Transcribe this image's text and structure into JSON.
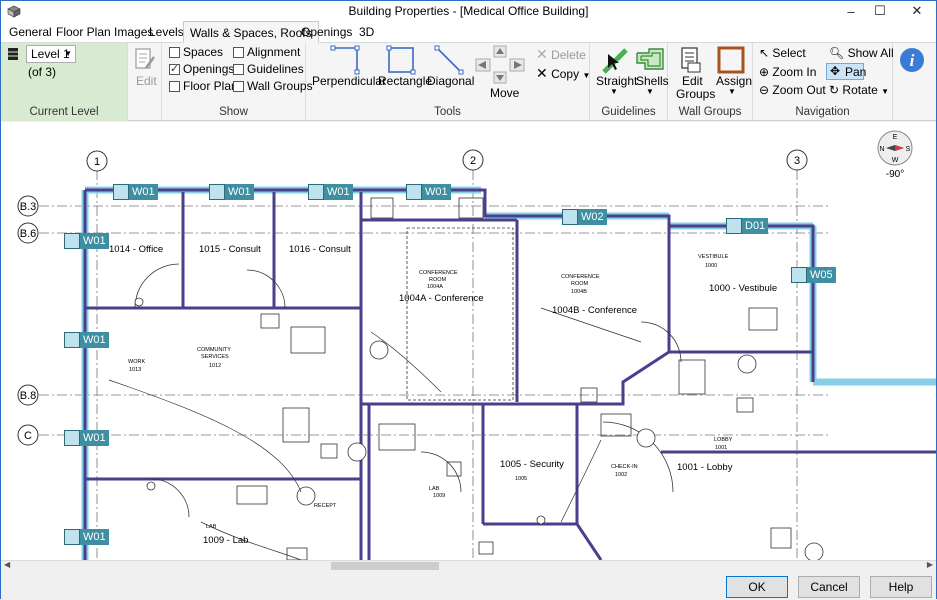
{
  "window": {
    "title": "Building Properties - [Medical Office Building]",
    "controls": {
      "minimize": "–",
      "maximize": "☐",
      "close": "✕"
    }
  },
  "menu": {
    "tabs": [
      "General",
      "Floor Plan Images",
      "Levels",
      "Walls & Spaces, Roofs",
      "Openings",
      "3D"
    ],
    "active": "Walls & Spaces, Roofs"
  },
  "ribbon": {
    "current_level": {
      "level_select": "Level 1",
      "of_text": "(of 3)",
      "group_label": "Current Level"
    },
    "edit": {
      "label": "Edit"
    },
    "show": {
      "group_label": "Show",
      "items": [
        {
          "label": "Spaces",
          "checked": false
        },
        {
          "label": "Openings",
          "checked": true
        },
        {
          "label": "Floor Plan",
          "checked": false
        },
        {
          "label": "Alignment",
          "checked": false
        },
        {
          "label": "Guidelines",
          "checked": false
        },
        {
          "label": "Wall Groups",
          "checked": false
        }
      ]
    },
    "tools": {
      "group_label": "Tools",
      "perpendicular": "Perpendicular",
      "rectangle": "Rectangle",
      "diagonal": "Diagonal",
      "move": "Move",
      "delete": "Delete",
      "copy": "Copy"
    },
    "guidelines": {
      "group_label": "Guidelines",
      "straight": "Straight",
      "shells": "Shells"
    },
    "wall_groups": {
      "group_label": "Wall Groups",
      "edit_groups_1": "Edit",
      "edit_groups_2": "Groups",
      "assign": "Assign"
    },
    "navigation": {
      "group_label": "Navigation",
      "select": "Select",
      "zoom_in": "Zoom In",
      "zoom_out": "Zoom Out",
      "show_all": "Show All",
      "pan": "Pan",
      "rotate": "Rotate"
    }
  },
  "canvas": {
    "compass": {
      "n": "N",
      "e": "E",
      "s": "S",
      "w": "W",
      "angle": "-90°"
    },
    "grid_labels": {
      "col1": "1",
      "col2": "2",
      "col3": "3",
      "b3": "B.3",
      "b6": "B.6",
      "b8": "B.8",
      "c": "C"
    },
    "wall_labels": [
      "W01",
      "W01",
      "W01",
      "W01",
      "W02",
      "D01",
      "W01",
      "W05",
      "W01",
      "W01",
      "W01"
    ],
    "rooms": {
      "r1014": "1014 - Office",
      "r1015": "1015 - Consult",
      "r1016": "1016 - Consult",
      "r1004a": "1004A - Conference",
      "r1004b": "1004B - Conference",
      "r1000": "1000 - Vestibule",
      "r1005": "1005 - Security",
      "r1001": "1001 - Lobby",
      "r1009": "1009 - Lab"
    },
    "small_text": {
      "conf_room_a": "CONFERENCE",
      "conf_room_a2": "ROOM",
      "conf_room_a_num": "1004A",
      "conf_room_b": "CONFERENCE",
      "conf_room_b2": "ROOM",
      "conf_room_b_num": "1004B",
      "vestibule": "VESTIBULE",
      "vestibule_num": "1000",
      "work": "WORK",
      "work_num": "1013",
      "community": "COMMUNITY",
      "services": "SERVICES",
      "community_num": "1012",
      "lobby": "LOBBY",
      "lobby_num": "1001",
      "checkin": "CHECK-IN",
      "checkin_num": "1002",
      "security_num": "1005",
      "recept": "RECEPT",
      "lab": "LAB",
      "lab_small": "LAB",
      "lab_num": "1009"
    }
  },
  "footer": {
    "ok": "OK",
    "cancel": "Cancel",
    "help": "Help"
  },
  "colors": {
    "wall": "#4a3f8c",
    "wall_accent": "#87cfe6",
    "label_bg": "#3d8fa1",
    "level_bg": "#d9ead3"
  }
}
